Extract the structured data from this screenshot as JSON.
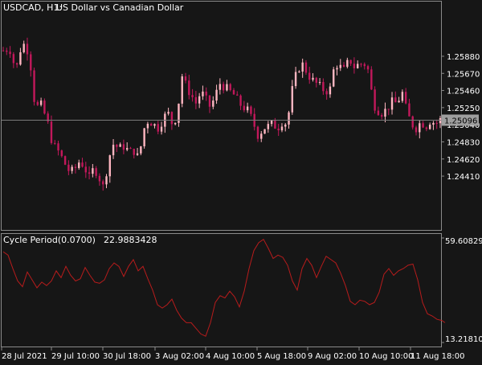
{
  "window": {
    "symbol": "USDCAD, H1:",
    "description": "US Dollar vs Canadian Dollar"
  },
  "indicator": {
    "label": "Cycle Period(0.0700)",
    "current_value": "22.9883428",
    "axis_max": "59.6082902",
    "axis_min": "13.2181016"
  },
  "colors": {
    "background": "#161616",
    "frame": "#8a8a8a",
    "text": "#ffffff",
    "bull_candle": "#ffb6c1",
    "bear_candle": "#c2185b",
    "price_line": "#7a7a7a",
    "price_label_bg": "#9e9e9e",
    "indicator_line": "#b71c1c"
  },
  "chart_data": [
    {
      "type": "candlestick",
      "title": "USDCAD, H1:",
      "subtitle": "US Dollar vs Canadian Dollar",
      "ylim": [
        1.2375,
        1.2655
      ],
      "y_ticks": [
        "1.25880",
        "1.25670",
        "1.25460",
        "1.25250",
        "1.25040",
        "1.24830",
        "1.24620",
        "1.24410"
      ],
      "y_tick_values": [
        1.2588,
        1.2567,
        1.2546,
        1.2525,
        1.2504,
        1.2483,
        1.2462,
        1.2441
      ],
      "current_price": 1.25096,
      "current_price_label": "1.25096",
      "x_ticks": [
        "28 Jul 2021",
        "29 Jul 10:00",
        "30 Jul 18:00",
        "3 Aug 02:00",
        "4 Aug 10:00",
        "5 Aug 18:00",
        "9 Aug 02:00",
        "10 Aug 10:00",
        "11 Aug 18:00"
      ],
      "close_path": [
        [
          0,
          1.2595
        ],
        [
          8,
          1.2598
        ],
        [
          16,
          1.257
        ],
        [
          22,
          1.2598
        ],
        [
          28,
          1.2605
        ],
        [
          34,
          1.258
        ],
        [
          40,
          1.2525
        ],
        [
          48,
          1.2528
        ],
        [
          56,
          1.2505
        ],
        [
          62,
          1.248
        ],
        [
          70,
          1.247
        ],
        [
          78,
          1.2455
        ],
        [
          84,
          1.2445
        ],
        [
          90,
          1.245
        ],
        [
          96,
          1.246
        ],
        [
          102,
          1.2452
        ],
        [
          108,
          1.2438
        ],
        [
          114,
          1.2452
        ],
        [
          120,
          1.244
        ],
        [
          126,
          1.2426
        ],
        [
          132,
          1.2462
        ],
        [
          138,
          1.248
        ],
        [
          146,
          1.2475
        ],
        [
          152,
          1.2478
        ],
        [
          158,
          1.247
        ],
        [
          164,
          1.2472
        ],
        [
          170,
          1.2462
        ],
        [
          176,
          1.2498
        ],
        [
          182,
          1.251
        ],
        [
          188,
          1.2505
        ],
        [
          194,
          1.25
        ],
        [
          200,
          1.251
        ],
        [
          206,
          1.252
        ],
        [
          212,
          1.2505
        ],
        [
          218,
          1.2515
        ],
        [
          224,
          1.2565
        ],
        [
          230,
          1.255
        ],
        [
          236,
          1.254
        ],
        [
          242,
          1.253
        ],
        [
          248,
          1.2545
        ],
        [
          254,
          1.2535
        ],
        [
          260,
          1.2525
        ],
        [
          266,
          1.254
        ],
        [
          272,
          1.2555
        ],
        [
          278,
          1.255
        ],
        [
          284,
          1.2545
        ],
        [
          290,
          1.254
        ],
        [
          296,
          1.253
        ],
        [
          302,
          1.2525
        ],
        [
          308,
          1.252
        ],
        [
          314,
          1.2505
        ],
        [
          320,
          1.249
        ],
        [
          326,
          1.25
        ],
        [
          332,
          1.2502
        ],
        [
          338,
          1.2505
        ],
        [
          344,
          1.25
        ],
        [
          350,
          1.2508
        ],
        [
          356,
          1.2505
        ],
        [
          362,
          1.2545
        ],
        [
          368,
          1.2568
        ],
        [
          374,
          1.258
        ],
        [
          380,
          1.257
        ],
        [
          386,
          1.256
        ],
        [
          392,
          1.2555
        ],
        [
          398,
          1.255
        ],
        [
          404,
          1.2545
        ],
        [
          410,
          1.2548
        ],
        [
          416,
          1.258
        ],
        [
          422,
          1.2575
        ],
        [
          428,
          1.257
        ],
        [
          434,
          1.2585
        ],
        [
          440,
          1.2575
        ],
        [
          446,
          1.2578
        ],
        [
          452,
          1.258
        ],
        [
          458,
          1.257
        ],
        [
          464,
          1.253
        ],
        [
          470,
          1.2522
        ],
        [
          476,
          1.2518
        ],
        [
          482,
          1.2525
        ],
        [
          488,
          1.2532
        ],
        [
          494,
          1.253
        ],
        [
          500,
          1.2545
        ],
        [
          506,
          1.252
        ],
        [
          512,
          1.2505
        ],
        [
          518,
          1.25
        ],
        [
          524,
          1.2508
        ],
        [
          530,
          1.2502
        ],
        [
          536,
          1.251
        ],
        [
          542,
          1.2505
        ],
        [
          548,
          1.251
        ]
      ]
    },
    {
      "type": "line",
      "title": "Cycle Period(0.0700)",
      "ylim": [
        13.2181016,
        59.6082902
      ],
      "y_ticks": [
        "59.6082902",
        "13.2181016"
      ],
      "series": [
        {
          "name": "Cycle Period(0.0700)",
          "points": [
            [
              0,
              53.5
            ],
            [
              6,
              52.0
            ],
            [
              12,
              46.0
            ],
            [
              18,
              40.5
            ],
            [
              24,
              38.0
            ],
            [
              30,
              44.5
            ],
            [
              36,
              41.0
            ],
            [
              42,
              37.5
            ],
            [
              48,
              40.0
            ],
            [
              54,
              38.5
            ],
            [
              60,
              40.5
            ],
            [
              66,
              45.0
            ],
            [
              72,
              42.0
            ],
            [
              78,
              47.0
            ],
            [
              84,
              43.0
            ],
            [
              90,
              40.5
            ],
            [
              96,
              41.5
            ],
            [
              102,
              46.5
            ],
            [
              108,
              43.0
            ],
            [
              114,
              40.0
            ],
            [
              120,
              39.5
            ],
            [
              126,
              41.0
            ],
            [
              132,
              46.0
            ],
            [
              138,
              48.5
            ],
            [
              144,
              47.0
            ],
            [
              150,
              42.5
            ],
            [
              156,
              47.0
            ],
            [
              162,
              50.0
            ],
            [
              168,
              45.0
            ],
            [
              174,
              47.0
            ],
            [
              180,
              41.5
            ],
            [
              186,
              36.5
            ],
            [
              192,
              30.0
            ],
            [
              198,
              28.5
            ],
            [
              204,
              30.0
            ],
            [
              210,
              32.5
            ],
            [
              216,
              27.5
            ],
            [
              222,
              24.0
            ],
            [
              228,
              22.0
            ],
            [
              234,
              22.0
            ],
            [
              240,
              19.5
            ],
            [
              246,
              17.0
            ],
            [
              252,
              16.0
            ],
            [
              258,
              22.0
            ],
            [
              264,
              31.0
            ],
            [
              270,
              34.0
            ],
            [
              276,
              33.0
            ],
            [
              282,
              36.0
            ],
            [
              288,
              33.5
            ],
            [
              294,
              29.0
            ],
            [
              300,
              36.0
            ],
            [
              306,
              46.0
            ],
            [
              312,
              54.0
            ],
            [
              318,
              57.5
            ],
            [
              324,
              59.0
            ],
            [
              330,
              55.0
            ],
            [
              336,
              50.5
            ],
            [
              342,
              52.0
            ],
            [
              348,
              51.0
            ],
            [
              354,
              47.5
            ],
            [
              360,
              40.5
            ],
            [
              366,
              36.5
            ],
            [
              372,
              46.0
            ],
            [
              378,
              50.5
            ],
            [
              384,
              47.5
            ],
            [
              390,
              42.0
            ],
            [
              396,
              47.0
            ],
            [
              402,
              51.5
            ],
            [
              408,
              50.0
            ],
            [
              414,
              48.5
            ],
            [
              420,
              44.0
            ],
            [
              426,
              38.5
            ],
            [
              432,
              31.5
            ],
            [
              438,
              30.0
            ],
            [
              444,
              32.0
            ],
            [
              450,
              31.5
            ],
            [
              456,
              30.0
            ],
            [
              462,
              31.0
            ],
            [
              468,
              35.5
            ],
            [
              474,
              43.5
            ],
            [
              480,
              46.0
            ],
            [
              486,
              43.0
            ],
            [
              492,
              45.0
            ],
            [
              498,
              46.0
            ],
            [
              504,
              47.5
            ],
            [
              510,
              48.0
            ],
            [
              516,
              41.0
            ],
            [
              522,
              31.0
            ],
            [
              528,
              26.0
            ],
            [
              534,
              25.0
            ],
            [
              540,
              23.5
            ],
            [
              546,
              23.0
            ],
            [
              550,
              22.0
            ]
          ]
        }
      ]
    }
  ]
}
